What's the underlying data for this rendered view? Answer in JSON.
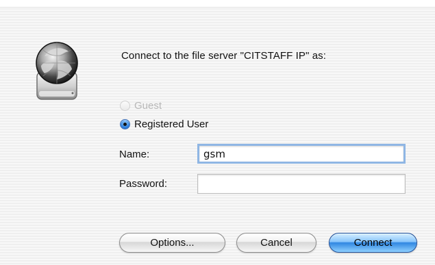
{
  "dialog": {
    "message": "Connect to the file server \"CITSTAFF IP\" as:",
    "server_icon": "globe-server-icon"
  },
  "auth_mode": {
    "guest_label": "Guest",
    "registered_label": "Registered User",
    "selected": "Registered User"
  },
  "fields": {
    "name_label": "Name:",
    "name_value": "gsm",
    "password_label": "Password:",
    "password_value": ""
  },
  "buttons": {
    "options": "Options...",
    "cancel": "Cancel",
    "connect": "Connect"
  },
  "colors": {
    "default_button": "#2f86e1",
    "focus_ring": "#8fb6e4"
  }
}
